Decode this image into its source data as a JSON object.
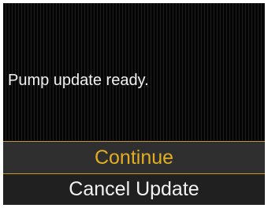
{
  "dialog": {
    "message": "Pump update ready.",
    "options": [
      {
        "label": "Continue",
        "selected": true
      },
      {
        "label": "Cancel Update",
        "selected": false
      }
    ]
  },
  "colors": {
    "background": "#050505",
    "selected_text": "#e2ad22",
    "divider": "#c69a1e",
    "text": "#f2f2f2"
  }
}
